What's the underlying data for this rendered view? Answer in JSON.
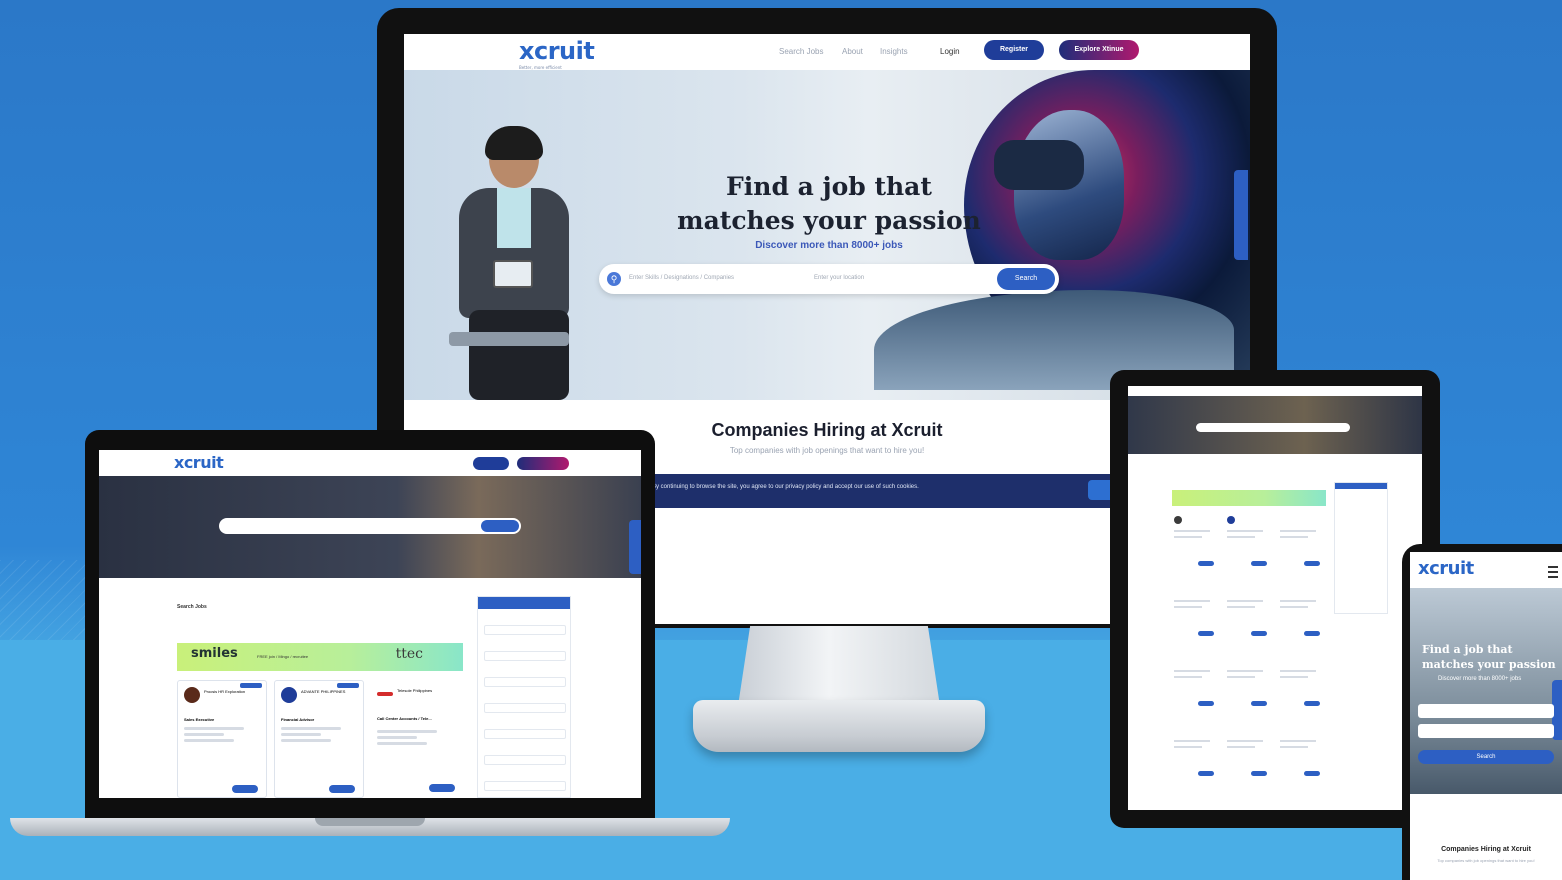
{
  "brand": {
    "name": "xcruit",
    "tagline": "Better, more efficient"
  },
  "nav": {
    "links": [
      "Search Jobs",
      "About",
      "Insights"
    ],
    "login": "Login",
    "register": "Register",
    "explore": "Explore Xtinue"
  },
  "hero": {
    "title_line1": "Find a job that",
    "title_line2": "matches your passion",
    "subtitle": "Discover more than 8000+ jobs",
    "search_placeholder": "Enter Skills / Designations / Companies",
    "location_placeholder": "Enter your location",
    "search_button": "Search"
  },
  "companies": {
    "title": "Companies Hiring at Xcruit",
    "subtitle": "Top companies with job openings that want to hire you!"
  },
  "cookie_notice": "By continuing to browse the site, you agree to our privacy policy and accept our use of such cookies.",
  "listing": {
    "title": "Search Jobs",
    "banner_left": "smiles",
    "banner_middle": "FREE join / Mingo / recruitee",
    "banner_right": "ttec",
    "cards": [
      {
        "company": "Procsis HR Exploration",
        "role": "Sales Executive"
      },
      {
        "company": "ADVANTE PHILIPPINES",
        "role": "Financial Advisor"
      },
      {
        "company": "Telesole Philippines",
        "role": "Call Center Accounts / Tele..."
      }
    ]
  },
  "phone": {
    "title_line1": "Find a job that",
    "title_line2": "matches your passion",
    "subtitle": "Discover more than 8000+ jobs",
    "search_button": "Search",
    "companies_title": "Companies Hiring at Xcruit",
    "companies_subtitle": "Top companies with job openings that want to hire you!"
  },
  "colors": {
    "primary": "#2d5fc3",
    "navy": "#1f3d99",
    "magenta": "#b0196e",
    "background": "#2f86d6"
  }
}
